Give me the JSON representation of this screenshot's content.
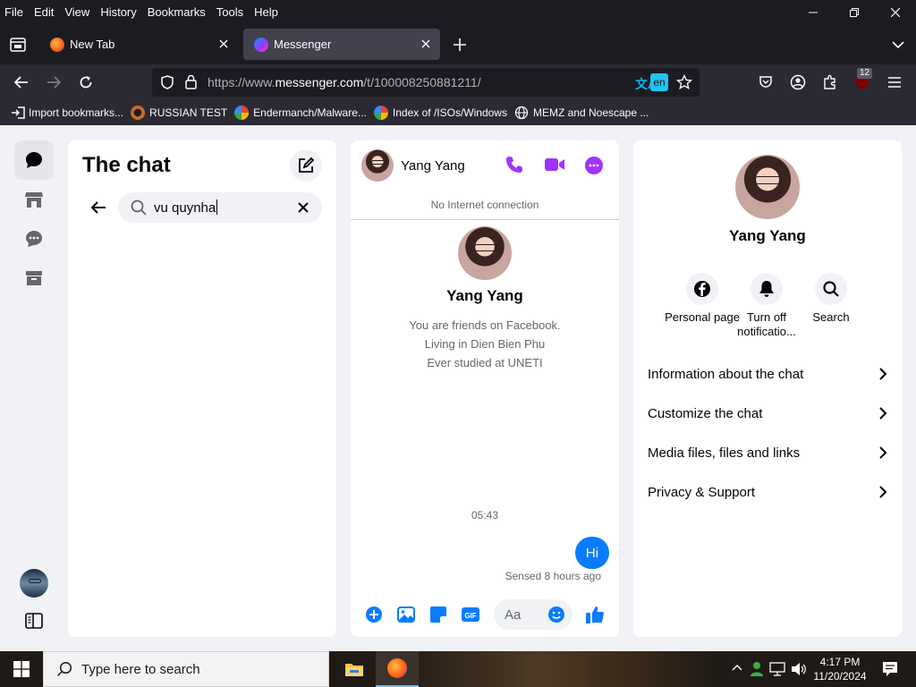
{
  "menubar": {
    "items": [
      "File",
      "Edit",
      "View",
      "History",
      "Bookmarks",
      "Tools",
      "Help"
    ]
  },
  "tabs": [
    {
      "label": "New Tab",
      "active": false
    },
    {
      "label": "Messenger",
      "active": true
    }
  ],
  "navbar": {
    "url_prefix": "https://www.",
    "url_host": "messenger.com",
    "url_path": "/t/100008250881211/",
    "translate_badge": "en",
    "extensions_badge": "12"
  },
  "bookmarks": [
    {
      "label": "Import bookmarks...",
      "icon": "import-icon"
    },
    {
      "label": "RUSSIAN TEST",
      "icon": "site-icon"
    },
    {
      "label": "Endermanch/Malware...",
      "icon": "google-icon"
    },
    {
      "label": "Index of /ISOs/Windows",
      "icon": "google-icon"
    },
    {
      "label": "MEMZ and Noescape ...",
      "icon": "globe-icon"
    }
  ],
  "chatlist": {
    "title": "The chat",
    "search_value": "vu quynha"
  },
  "conversation": {
    "contact_name": "Yang Yang",
    "status": "No Internet connection",
    "intro_name": "Yang Yang",
    "intro_lines": [
      "You are friends on Facebook.",
      "Living in Dien Bien Phu",
      "Ever studied at UNETI"
    ],
    "timestamp": "05:43",
    "message": "Hi",
    "sent_status": "Sensed 8 hours ago",
    "input_placeholder": "Aa"
  },
  "details": {
    "name": "Yang Yang",
    "actions": [
      {
        "label": "Personal page",
        "icon": "facebook-icon"
      },
      {
        "label": "Turn off notificatio...",
        "icon": "bell-icon"
      },
      {
        "label": "Search",
        "icon": "search-icon"
      }
    ],
    "rows": [
      "Information about the chat",
      "Customize the chat",
      "Media files, files and links",
      "Privacy & Support"
    ]
  },
  "taskbar": {
    "search_placeholder": "Type here to search",
    "time": "4:17 PM",
    "date": "11/20/2024"
  },
  "colors": {
    "messenger_blue": "#0a7cff",
    "messenger_purple": "#a033ff",
    "page_bg": "#f0f2f5",
    "browser_dark": "#1c1b22"
  }
}
